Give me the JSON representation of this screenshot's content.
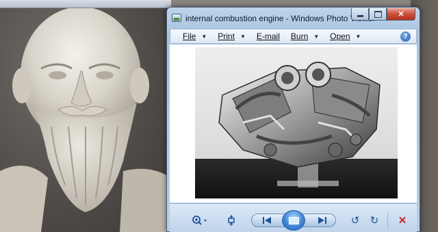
{
  "window": {
    "title": "internal combustion engine - Windows Photo Viewer"
  },
  "menu": {
    "items": [
      {
        "label": "File",
        "has_dropdown": true
      },
      {
        "label": "Print",
        "has_dropdown": true
      },
      {
        "label": "E-mail",
        "has_dropdown": false
      },
      {
        "label": "Burn",
        "has_dropdown": true
      },
      {
        "label": "Open",
        "has_dropdown": true
      }
    ],
    "help_icon": "help-icon"
  },
  "image": {
    "subject": "engine-photo"
  },
  "controls": {
    "icons": [
      "zoom-icon",
      "fit-to-window-icon",
      "previous-icon",
      "slideshow-icon",
      "next-icon",
      "rotate-counterclockwise-icon",
      "rotate-clockwise-icon",
      "delete-icon"
    ]
  },
  "colors": {
    "frame": "#b7cde6",
    "close_button": "#c8503a",
    "accent": "#1b4f9a",
    "delete": "#c62828"
  }
}
